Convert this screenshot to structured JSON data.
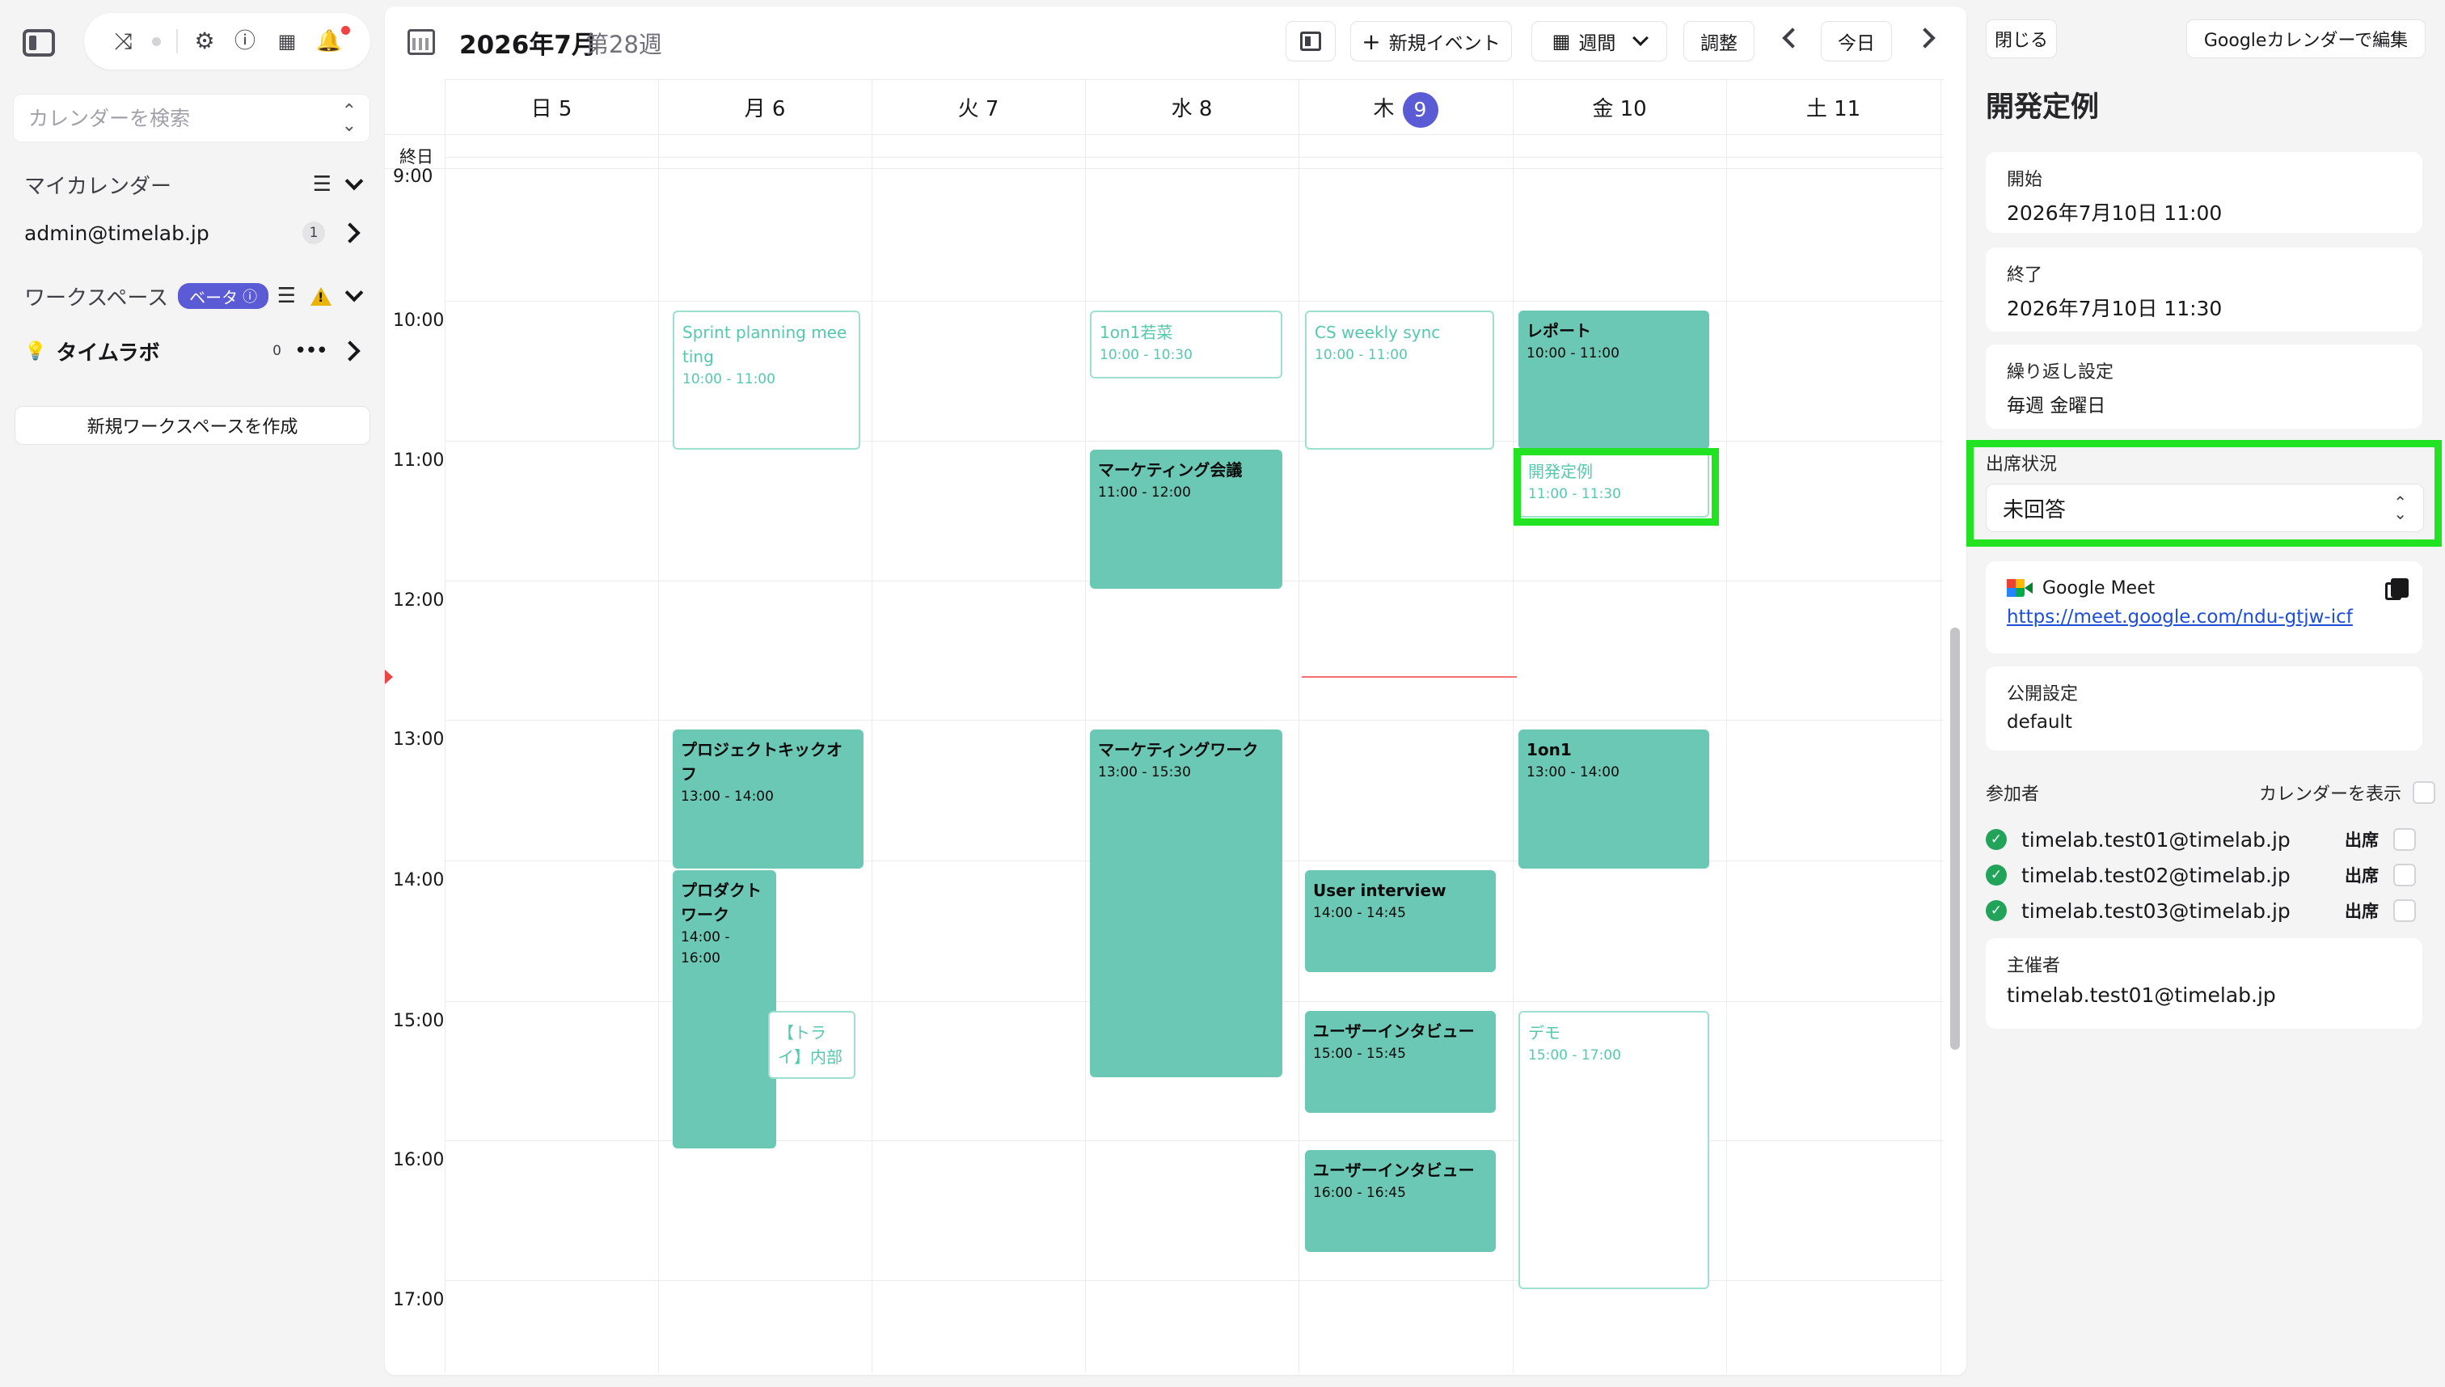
{
  "sidebar": {
    "search_placeholder": "カレンダーを検索",
    "my_calendar": {
      "label": "マイカレンダー",
      "account": "admin@timelab.jp",
      "count": "1"
    },
    "workspace": {
      "label": "ワークスペース",
      "beta_badge": "ベータ",
      "item_name": "タイムラボ",
      "item_count": "0"
    },
    "new_workspace_button": "新規ワークスペースを作成"
  },
  "header": {
    "title": "2026年7月",
    "week": "第28週",
    "new_event_label": "新規イベント",
    "view_label": "週間",
    "adjust_label": "調整",
    "today_label": "今日"
  },
  "days": [
    {
      "label": "日 5"
    },
    {
      "label": "月 6"
    },
    {
      "label": "火 7"
    },
    {
      "label": "水 8"
    },
    {
      "label": "木",
      "today_num": "9"
    },
    {
      "label": "金 10"
    },
    {
      "label": "土 11"
    }
  ],
  "allday_label": "終日",
  "time_labels": [
    "9:00",
    "10:00",
    "11:00",
    "12:00",
    "13:00",
    "14:00",
    "15:00",
    "16:00",
    "17:00"
  ],
  "events": [
    {
      "title": "Sprint planning meeting",
      "time": "10:00 - 11:00",
      "style": "outline"
    },
    {
      "title": "1on1若菜",
      "time": "10:00 - 10:30",
      "style": "outline"
    },
    {
      "title": "CS weekly sync",
      "time": "10:00 - 11:00",
      "style": "outline"
    },
    {
      "title": "レポート",
      "time": "10:00 - 11:00",
      "style": "solid"
    },
    {
      "title": "マーケティング会議",
      "time": "11:00 - 12:00",
      "style": "solid"
    },
    {
      "title": "開発定例",
      "time": "11:00 - 11:30",
      "style": "outline"
    },
    {
      "title": "プロジェクトキックオフ",
      "time": "13:00 - 14:00",
      "style": "solid"
    },
    {
      "title": "マーケティングワーク",
      "time": "13:00 - 15:30",
      "style": "solid"
    },
    {
      "title": "1on1",
      "time": "13:00 - 14:00",
      "style": "solid"
    },
    {
      "title": "プロダクトワーク",
      "time": "14:00 - 16:00",
      "style": "solid"
    },
    {
      "title": "User interview",
      "time": "14:00 - 14:45",
      "style": "solid"
    },
    {
      "title": "【トライ】内部",
      "time": "",
      "style": "outline"
    },
    {
      "title": "ユーザーインタビュー",
      "time": "15:00 - 15:45",
      "style": "solid"
    },
    {
      "title": "デモ",
      "time": "15:00 - 17:00",
      "style": "outline"
    },
    {
      "title": "ユーザーインタビュー",
      "time": "16:00 - 16:45",
      "style": "solid"
    }
  ],
  "panel": {
    "close_label": "閉じる",
    "edit_google_label": "Googleカレンダーで編集",
    "event_title": "開発定例",
    "start_label": "開始",
    "start_value": "2026年7月10日 11:00",
    "end_label": "終了",
    "end_value": "2026年7月10日 11:30",
    "recurrence_label": "繰り返し設定",
    "recurrence_value": "毎週 金曜日",
    "attendance_label": "出席状況",
    "attendance_value": "未回答",
    "meet_label": "Google Meet",
    "meet_link": "https://meet.google.com/ndu-gtjw-icf",
    "visibility_label": "公開設定",
    "visibility_value": "default",
    "participants_label": "参加者",
    "show_calendar_label": "カレンダーを表示",
    "attendees": [
      {
        "email": "timelab.test01@timelab.jp",
        "status": "出席"
      },
      {
        "email": "timelab.test02@timelab.jp",
        "status": "出席"
      },
      {
        "email": "timelab.test03@timelab.jp",
        "status": "出席"
      }
    ],
    "organizer_label": "主催者",
    "organizer_value": "timelab.test01@timelab.jp"
  },
  "colors": {
    "event_solid": "#6bc8b4",
    "event_outline_text": "#55c8ad",
    "accent": "#5b5bd6",
    "highlight": "#22e322",
    "now_line": "#f87171"
  }
}
